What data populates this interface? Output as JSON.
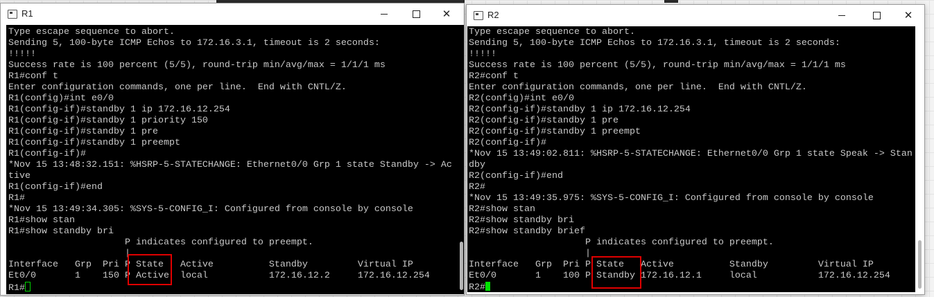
{
  "windows": [
    {
      "title": "R1",
      "lines": [
        "Type escape sequence to abort.",
        "Sending 5, 100-byte ICMP Echos to 172.16.3.1, timeout is 2 seconds:",
        "!!!!!",
        "Success rate is 100 percent (5/5), round-trip min/avg/max = 1/1/1 ms",
        "R1#conf t",
        "Enter configuration commands, one per line.  End with CNTL/Z.",
        "R1(config)#int e0/0",
        "R1(config-if)#standby 1 ip 172.16.12.254",
        "R1(config-if)#standby 1 priority 150",
        "R1(config-if)#standby 1 pre",
        "R1(config-if)#standby 1 preempt",
        "R1(config-if)#",
        "*Nov 15 13:48:32.151: %HSRP-5-STATECHANGE: Ethernet0/0 Grp 1 state Standby -> Ac",
        "tive",
        "R1(config-if)#end",
        "R1#",
        "*Nov 15 13:49:34.305: %SYS-5-CONFIG_I: Configured from console by console",
        "R1#show stan",
        "R1#show standby bri",
        "                     P indicates configured to preempt.",
        "                     |",
        "Interface   Grp  Pri P State   Active          Standby         Virtual IP",
        "Et0/0       1    150 P Active  local           172.16.12.2     172.16.12.254"
      ],
      "prompt": "R1#"
    },
    {
      "title": "R2",
      "lines": [
        "Type escape sequence to abort.",
        "Sending 5, 100-byte ICMP Echos to 172.16.3.1, timeout is 2 seconds:",
        "!!!!!",
        "Success rate is 100 percent (5/5), round-trip min/avg/max = 1/1/1 ms",
        "R2#conf t",
        "Enter configuration commands, one per line.  End with CNTL/Z.",
        "R2(config)#int e0/0",
        "R2(config-if)#standby 1 ip 172.16.12.254",
        "R2(config-if)#standby 1 pre",
        "R2(config-if)#standby 1 preempt",
        "R2(config-if)#",
        "*Nov 15 13:49:02.811: %HSRP-5-STATECHANGE: Ethernet0/0 Grp 1 state Speak -> Stan",
        "dby",
        "R2(config-if)#end",
        "R2#",
        "*Nov 15 13:49:35.975: %SYS-5-CONFIG_I: Configured from console by console",
        "R2#show stan",
        "R2#show standby bri",
        "R2#show standby brief",
        "                     P indicates configured to preempt.",
        "                     |",
        "Interface   Grp  Pri P State   Active          Standby         Virtual IP",
        "Et0/0       1    100 P Standby 172.16.12.1     local           172.16.12.254"
      ],
      "prompt": "R2#"
    }
  ],
  "icons": {
    "app": "terminal-app-icon",
    "minimize": "minimize-icon",
    "maximize": "maximize-icon",
    "close": "close-icon"
  },
  "glyphs": {
    "close": "✕"
  },
  "colors": {
    "terminal_bg": "#000000",
    "terminal_text": "#c8c8c8",
    "cursor": "#00e000",
    "highlight_box": "#e00000"
  }
}
